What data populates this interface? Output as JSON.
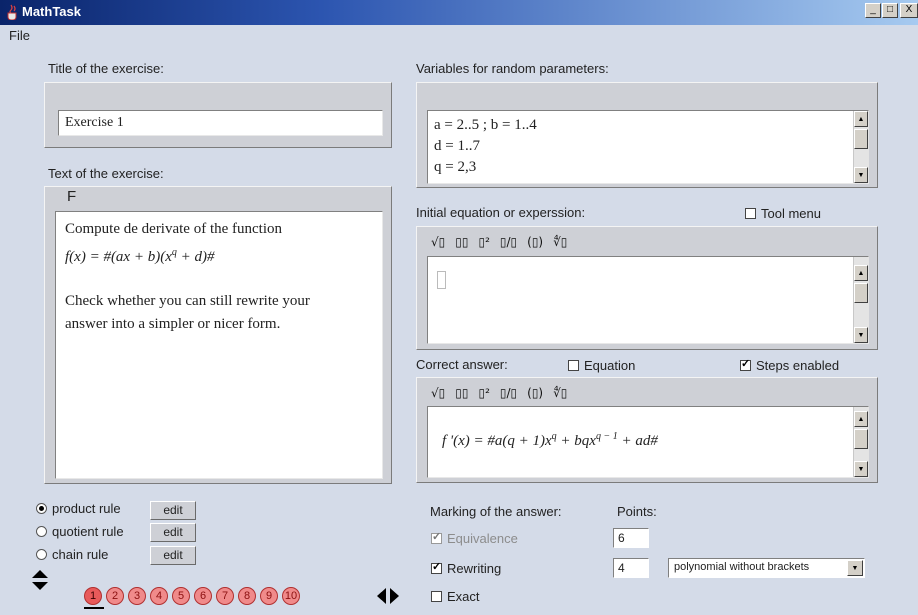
{
  "window": {
    "title": "MathTask",
    "controls": [
      "_",
      "□",
      "X"
    ]
  },
  "menu": {
    "file": "File"
  },
  "title_section": {
    "label": "Title of the exercise:",
    "value": "Exercise 1"
  },
  "text_section": {
    "label": "Text  of the exercise:",
    "toolbar_f": "F",
    "line1": "Compute de derivate of the function",
    "formula": "f(x) = #(ax  + b)(x",
    "formula_exp": "q",
    "formula_tail": " + d)#",
    "line3": "Check whether you can still rewrite your",
    "line4": "answer into a simpler or nicer form."
  },
  "variables_section": {
    "label": "Variables for random parameters:",
    "lines": [
      "a = 2..5 ; b =  1..4",
      "d = 1..7",
      "q = 2,3"
    ]
  },
  "initial_section": {
    "label": "Initial equation or experssion:",
    "tool_menu_label": "Tool menu",
    "tool_menu_checked": false
  },
  "toolbar_buttons": [
    "√▯",
    "▯▯",
    "▯²",
    "▯/▯",
    "(▯)",
    "∜▯"
  ],
  "correct_section": {
    "label": "Correct answer:",
    "equation_label": "Equation",
    "equation_checked": false,
    "steps_label": "Steps enabled",
    "steps_checked": true,
    "formula_start": "f '(x) = #a(q + 1)x",
    "formula_exp1": "q",
    "formula_mid": " + bqx",
    "formula_exp2": "q − 1",
    "formula_end": " + ad#"
  },
  "rules": [
    {
      "label": "product rule",
      "selected": true,
      "button": "edit"
    },
    {
      "label": "quotient rule",
      "selected": false,
      "button": "edit"
    },
    {
      "label": "chain rule",
      "selected": false,
      "button": "edit"
    }
  ],
  "pages": [
    "1",
    "2",
    "3",
    "4",
    "5",
    "6",
    "7",
    "8",
    "9",
    "10"
  ],
  "current_page": "1",
  "marking": {
    "label": "Marking of the answer:",
    "points_label": "Points:",
    "items": [
      {
        "label": "Equivalence",
        "checked": true,
        "disabled": true,
        "points": "6"
      },
      {
        "label": "Rewriting",
        "checked": true,
        "disabled": false,
        "points": "4"
      },
      {
        "label": "Exact",
        "checked": false,
        "disabled": false
      }
    ],
    "rewrite_option": "polynomial without brackets"
  }
}
